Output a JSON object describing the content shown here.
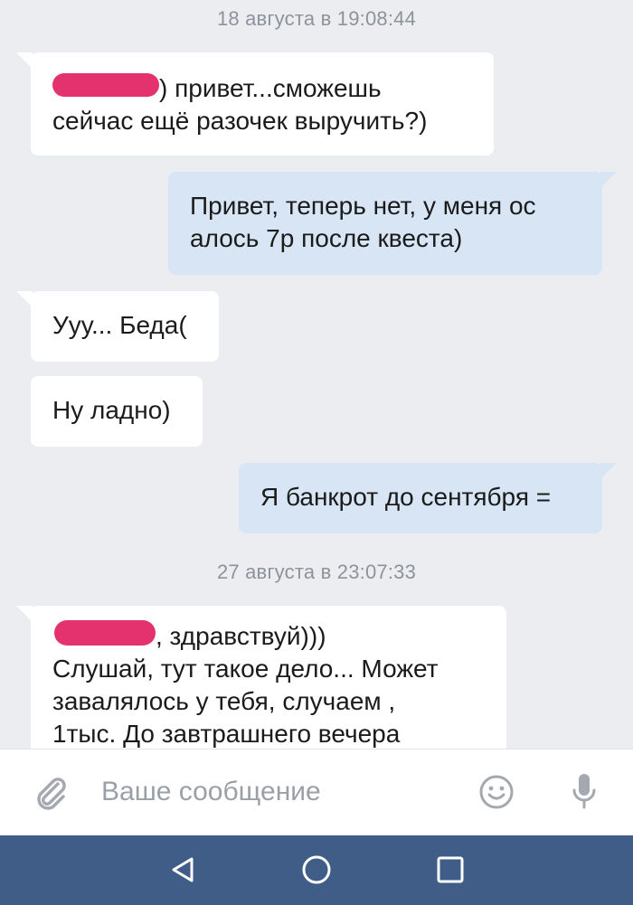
{
  "messages": [
    {
      "type": "date",
      "text": "18 августа в 19:08:44"
    },
    {
      "type": "in",
      "line1": ") привет...сможешь",
      "line2": "сейчас ещё разочек выручить?)"
    },
    {
      "type": "out",
      "line1": "Привет, теперь нет, у меня ос",
      "line2": "алось 7р после квеста)"
    },
    {
      "type": "in",
      "text": "Ууу... Беда("
    },
    {
      "type": "in",
      "text": "Ну ладно)"
    },
    {
      "type": "out",
      "text": "Я банкрот до сентября ="
    },
    {
      "type": "date",
      "text": "27 августа в 23:07:33"
    },
    {
      "type": "in",
      "line1": ", здравствуй)))",
      "line2": "Слушай, тут такое дело... Может",
      "line3": "завалялось у тебя, случаем ,",
      "line4": "1тыс. До завтрашнего вечера"
    }
  ],
  "composer": {
    "placeholder": "Ваше сообщение"
  },
  "icons": {
    "attach": "paperclip-icon",
    "emoji": "smile-icon",
    "voice": "microphone-icon",
    "back": "back-triangle-icon",
    "home": "home-circle-icon",
    "recents": "recents-square-icon"
  },
  "colors": {
    "background": "#ebedf1",
    "incoming_bubble": "#ffffff",
    "outgoing_bubble": "#d7e5f5",
    "redaction": "#e4326f",
    "navbar": "#3f5d86"
  }
}
